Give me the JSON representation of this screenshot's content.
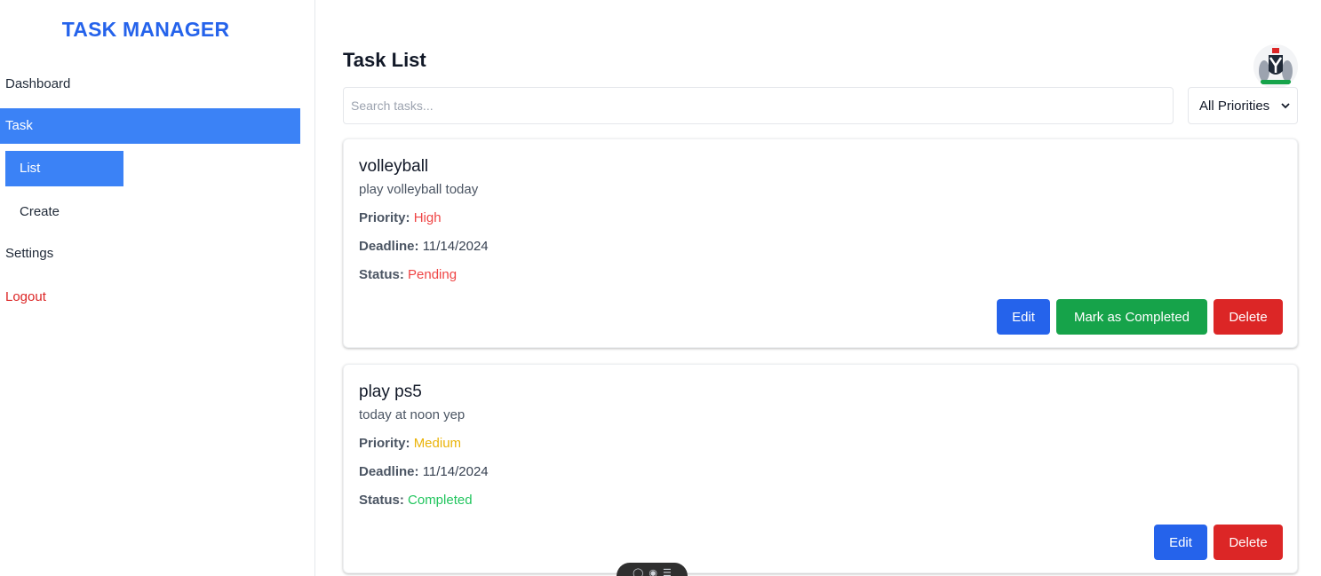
{
  "sidebar": {
    "brand": "TASK MANAGER",
    "items": {
      "dashboard": "Dashboard",
      "task": "Task",
      "list": "List",
      "create": "Create",
      "settings": "Settings",
      "logout": "Logout"
    },
    "active_item": "Task",
    "active_subitem": "List"
  },
  "header": {
    "title": "Task List",
    "avatar_icon": "coat-of-arms-avatar"
  },
  "filters": {
    "search_placeholder": "Search tasks...",
    "search_value": "",
    "priority_selected": "All Priorities"
  },
  "tasks": [
    {
      "title": "volleyball",
      "description": "play volleyball today",
      "priority_label": "Priority:",
      "priority": "High",
      "priority_color": "#ef4444",
      "deadline_label": "Deadline:",
      "deadline": "11/14/2024",
      "status_label": "Status:",
      "status": "Pending",
      "status_color": "#ef4444",
      "actions": {
        "edit": "Edit",
        "complete": "Mark as Completed",
        "delete": "Delete"
      }
    },
    {
      "title": "play ps5",
      "description": "today at noon yep",
      "priority_label": "Priority:",
      "priority": "Medium",
      "priority_color": "#eab308",
      "deadline_label": "Deadline:",
      "deadline": "11/14/2024",
      "status_label": "Status:",
      "status": "Completed",
      "status_color": "#22c55e",
      "actions": {
        "edit": "Edit",
        "delete": "Delete"
      }
    }
  ],
  "colors": {
    "accent": "#3b82f6",
    "brand": "#2563eb",
    "edit_button": "#2563eb",
    "complete_button": "#16a34a",
    "delete_button": "#dc2626",
    "logout": "#dc2626"
  }
}
